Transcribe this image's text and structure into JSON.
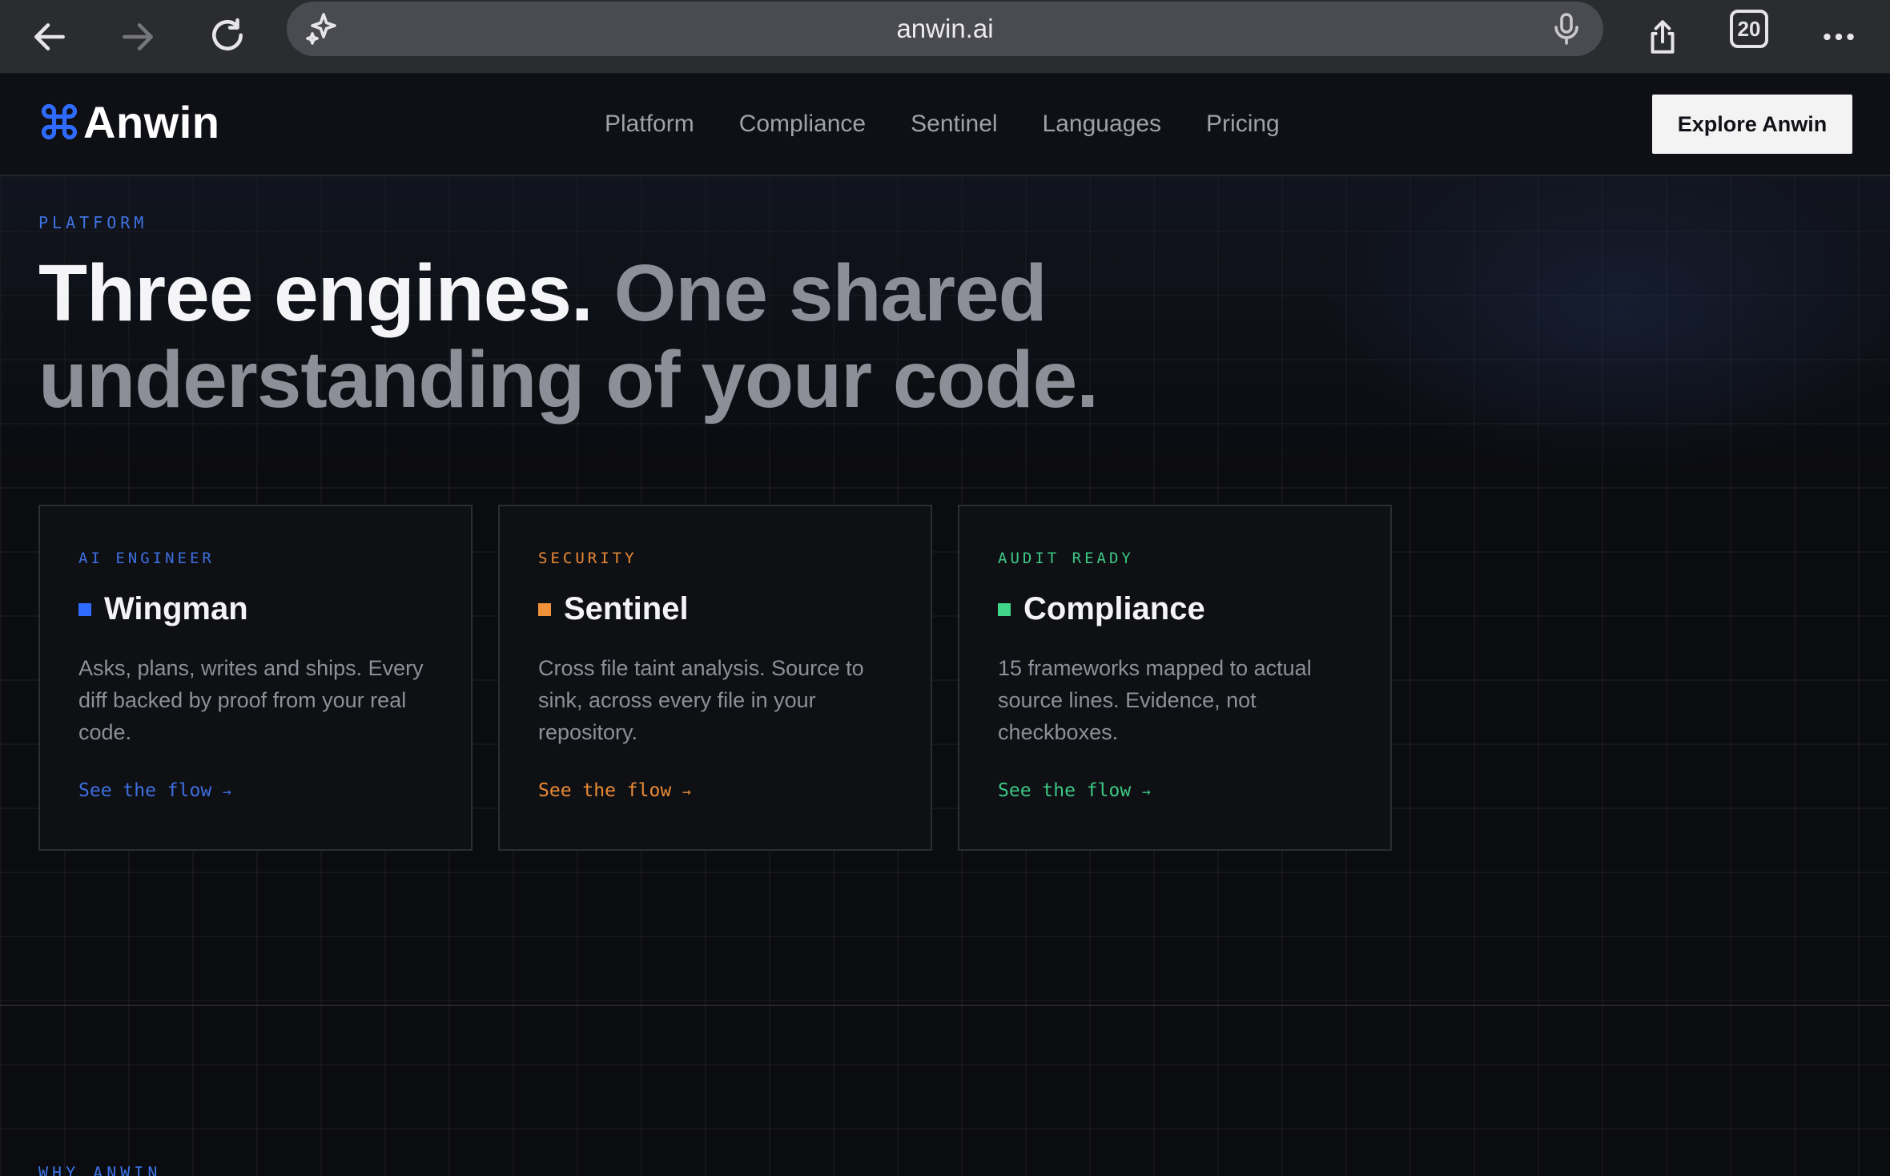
{
  "browser": {
    "url": "anwin.ai",
    "tab_count": "20",
    "icons": {
      "back": "arrow-left-icon",
      "forward": "arrow-right-icon",
      "reload": "reload-icon",
      "assistant": "sparkle-icon",
      "voice": "microphone-icon",
      "share": "share-icon",
      "tabs": "tabs-icon",
      "more": "more-dots-icon"
    }
  },
  "header": {
    "logo_text": "Anwin",
    "nav": [
      "Platform",
      "Compliance",
      "Sentinel",
      "Languages",
      "Pricing"
    ],
    "cta_label": "Explore Anwin"
  },
  "hero": {
    "eyebrow": "PLATFORM",
    "headline_strong": "Three engines.",
    "headline_muted": "One shared understanding of your code."
  },
  "cards": [
    {
      "tag": "AI ENGINEER",
      "title": "Wingman",
      "description": "Asks, plans, writes and ships. Every diff backed by proof from your real code.",
      "link": "See the flow",
      "accent": "#2f6bff"
    },
    {
      "tag": "SECURITY",
      "title": "Sentinel",
      "description": "Cross file taint analysis. Source to sink, across every file in your repository.",
      "link": "See the flow",
      "accent": "#f0923a"
    },
    {
      "tag": "AUDIT READY",
      "title": "Compliance",
      "description": "15 frameworks mapped to actual source lines. Evidence, not checkboxes.",
      "link": "See the flow",
      "accent": "#3fd68a"
    }
  ],
  "next_section": {
    "eyebrow": "WHY ANWIN"
  },
  "colors": {
    "background": "#0b0c10",
    "brand_blue": "#2f6bff",
    "text_muted": "#8d8f98"
  }
}
